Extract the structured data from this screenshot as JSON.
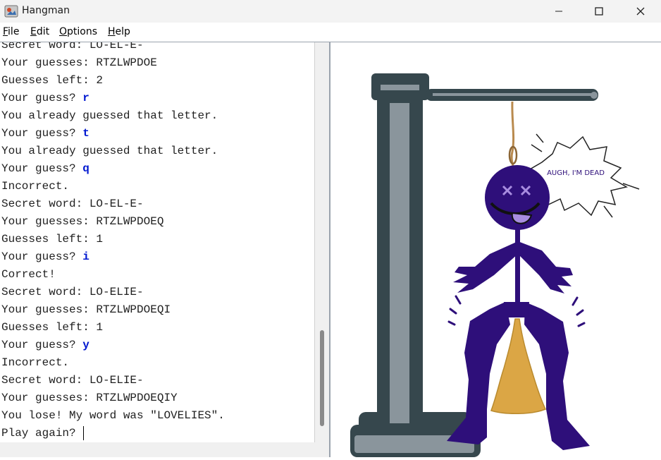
{
  "window": {
    "title": "Hangman"
  },
  "menu": [
    {
      "mnemonic": "F",
      "rest": "ile"
    },
    {
      "mnemonic": "E",
      "rest": "dit"
    },
    {
      "mnemonic": "O",
      "rest": "ptions"
    },
    {
      "mnemonic": "H",
      "rest": "elp"
    }
  ],
  "console": {
    "lines": [
      {
        "text": "Secret word: LO-EL-E-",
        "input": ""
      },
      {
        "text": "Your guesses: RTZLWPDOE",
        "input": ""
      },
      {
        "text": "Guesses left: 2",
        "input": ""
      },
      {
        "text": "Your guess? ",
        "input": "r"
      },
      {
        "text": "You already guessed that letter.",
        "input": ""
      },
      {
        "text": "Your guess? ",
        "input": "t"
      },
      {
        "text": "You already guessed that letter.",
        "input": ""
      },
      {
        "text": "Your guess? ",
        "input": "q"
      },
      {
        "text": "Incorrect.",
        "input": ""
      },
      {
        "text": "Secret word: LO-EL-E-",
        "input": ""
      },
      {
        "text": "Your guesses: RTZLWPDOEQ",
        "input": ""
      },
      {
        "text": "Guesses left: 1",
        "input": ""
      },
      {
        "text": "Your guess? ",
        "input": "i"
      },
      {
        "text": "Correct!",
        "input": ""
      },
      {
        "text": "Secret word: LO-ELIE-",
        "input": ""
      },
      {
        "text": "Your guesses: RTZLWPDOEQI",
        "input": ""
      },
      {
        "text": "Guesses left: 1",
        "input": ""
      },
      {
        "text": "Your guess? ",
        "input": "y"
      },
      {
        "text": "Incorrect.",
        "input": ""
      },
      {
        "text": "Secret word: LO-ELIE-",
        "input": ""
      },
      {
        "text": "Your guesses: RTZLWPDOEQIY",
        "input": ""
      },
      {
        "text": "You lose! My word was \"LOVELIES\".",
        "input": ""
      },
      {
        "text": "Play again? ",
        "input": "",
        "caret": true
      }
    ]
  },
  "drawing": {
    "speech_bubble_text": "AUGH, I'M DEAD",
    "colors": {
      "figure": "#2e0f7a",
      "gallows": "#36474d",
      "gallows_light": "#8a959c",
      "rope": "#b98a4e",
      "puddle": "#dba645",
      "tongue": "#a88de0",
      "eyes": "#a88de0"
    }
  }
}
